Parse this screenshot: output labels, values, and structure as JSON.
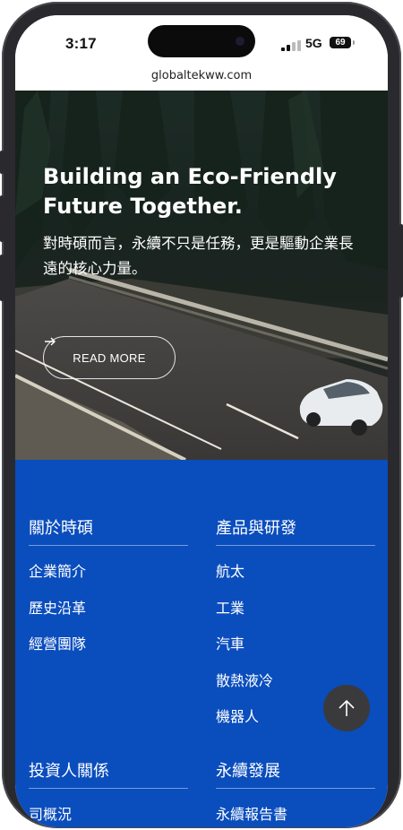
{
  "status": {
    "time": "3:17",
    "network": "5G",
    "battery": "69"
  },
  "browser": {
    "url": "globaltekww.com"
  },
  "hero": {
    "title": "Building an Eco-Friendly Future Together.",
    "text": "對時碩而言，永續不只是任務，更是驅動企業長遠的核心力量。",
    "button_label": "READ MORE",
    "button_icon": "arrow-right-icon"
  },
  "footer": {
    "background": "#0a4dbd",
    "columns": [
      {
        "title": "關於時碩",
        "items": [
          "企業簡介",
          "歷史沿革",
          "經營團隊"
        ]
      },
      {
        "title": "產品與研發",
        "items": [
          "航太",
          "工業",
          "汽車",
          "散熱液冷",
          "機器人"
        ]
      },
      {
        "title": "投資人關係",
        "items": [
          "司概況"
        ]
      },
      {
        "title": "永續發展",
        "items": [
          "永續報告書"
        ]
      }
    ]
  },
  "back_to_top": {
    "icon": "arrow-up-icon"
  }
}
